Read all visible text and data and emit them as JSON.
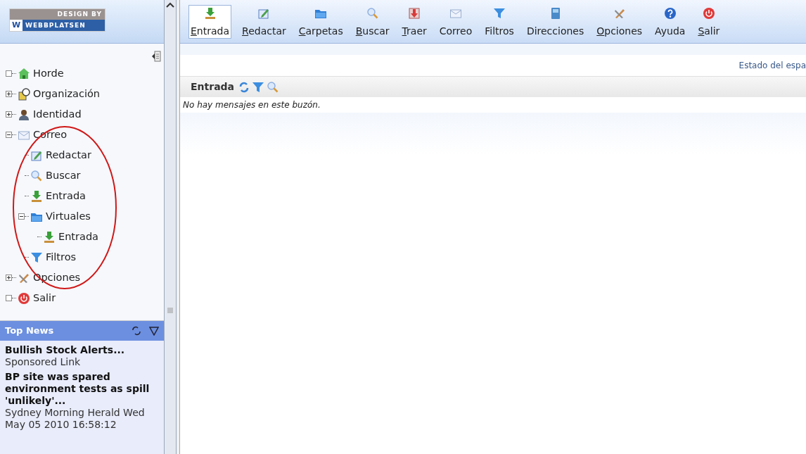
{
  "logo": {
    "top": "DESIGN BY",
    "letter": "W",
    "name": "WEBBPLATSEN"
  },
  "toolbar": [
    {
      "kind": "inbox",
      "label": "Entrada",
      "accesskey": true,
      "selected": true
    },
    {
      "kind": "compose",
      "label": "Redactar",
      "accesskey": true,
      "selected": false
    },
    {
      "kind": "folders",
      "label": "Carpetas",
      "accesskey": true,
      "selected": false
    },
    {
      "kind": "search",
      "label": "Buscar",
      "accesskey": true,
      "selected": false
    },
    {
      "kind": "fetch",
      "label": "Traer",
      "accesskey": true,
      "selected": false
    },
    {
      "kind": "mail",
      "label": "Correo",
      "accesskey": false,
      "selected": false
    },
    {
      "kind": "filters",
      "label": "Filtros",
      "accesskey": false,
      "selected": false
    },
    {
      "kind": "addressbook",
      "label": "Direcciones",
      "accesskey": false,
      "selected": false
    },
    {
      "kind": "options",
      "label": "Opciones",
      "accesskey": true,
      "selected": false
    },
    {
      "kind": "help",
      "label": "Ayuda",
      "accesskey": false,
      "selected": false
    },
    {
      "kind": "logout",
      "label": "Salir",
      "accesskey": true,
      "selected": false
    }
  ],
  "sidebar": {
    "tree": [
      {
        "kind": "home",
        "label": "Horde",
        "leaf": true
      },
      {
        "kind": "org",
        "label": "Organización",
        "expanded": false
      },
      {
        "kind": "identity",
        "label": "Identidad",
        "expanded": false
      },
      {
        "kind": "mail",
        "label": "Correo",
        "expanded": true,
        "children": [
          {
            "kind": "compose",
            "label": "Redactar"
          },
          {
            "kind": "search",
            "label": "Buscar"
          },
          {
            "kind": "inbox",
            "label": "Entrada"
          },
          {
            "kind": "folders",
            "label": "Virtuales",
            "expanded": true,
            "children": [
              {
                "kind": "inbox",
                "label": "Entrada"
              }
            ]
          },
          {
            "kind": "filters",
            "label": "Filtros"
          }
        ]
      },
      {
        "kind": "options",
        "label": "Opciones",
        "expanded": false
      },
      {
        "kind": "logout",
        "label": "Salir",
        "leaf": true
      }
    ]
  },
  "news": {
    "title": "Top News",
    "items": [
      {
        "headline": "Bullish Stock Alerts...",
        "source": "Sponsored Link"
      },
      {
        "headline": "BP site was spared environment tests as spill 'unlikely'...",
        "source": "Sydney Morning Herald Wed May 05 2010 16:58:12"
      }
    ]
  },
  "main": {
    "quota": "Estado del espa",
    "mailbox": {
      "title": "Entrada",
      "empty_message": "No hay mensajes en este buzón."
    }
  }
}
